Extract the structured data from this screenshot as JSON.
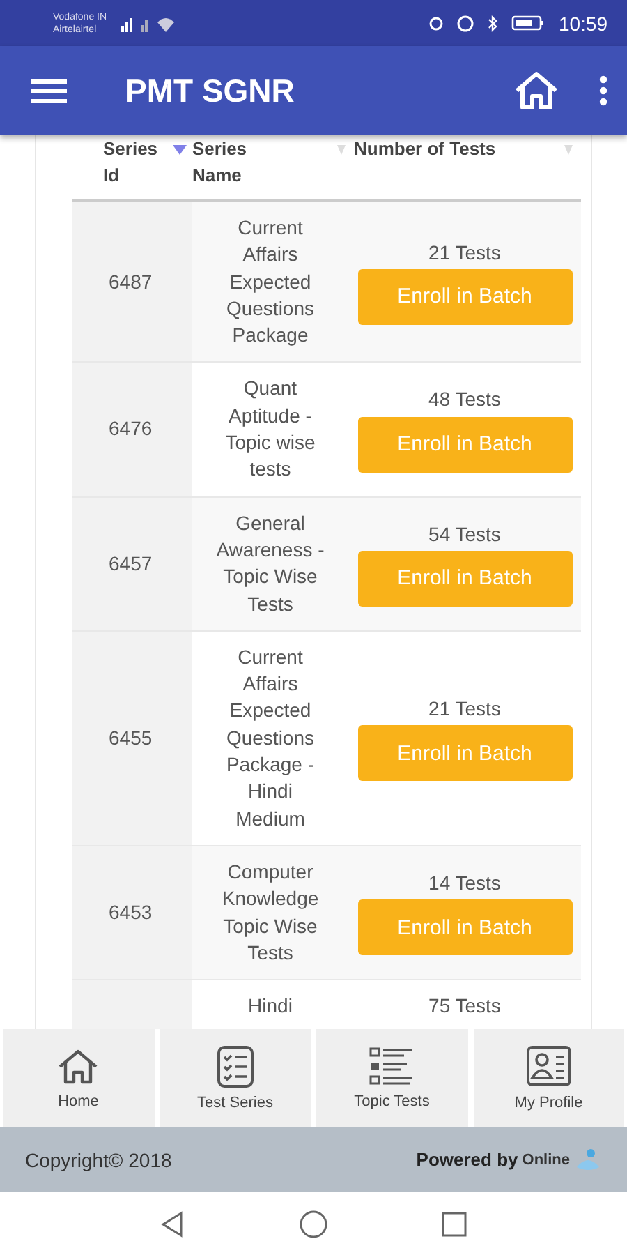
{
  "status_bar": {
    "carrier_lines": [
      "Vodafone IN",
      "Airtelairtel"
    ],
    "time": "10:59"
  },
  "app_bar": {
    "title": "PMT SGNR"
  },
  "table": {
    "columns": [
      {
        "label": "Series Id",
        "sorted": true
      },
      {
        "label": "Series Name",
        "sorted": false
      },
      {
        "label": "Number of Tests",
        "sorted": false
      }
    ],
    "rows": [
      {
        "id": "6487",
        "name": "Current Affairs Expected Questions Package",
        "tests": "21 Tests",
        "action": "Enroll in Batch"
      },
      {
        "id": "6476",
        "name": "Quant Aptitude - Topic wise tests",
        "tests": "48 Tests",
        "action": "Enroll in Batch"
      },
      {
        "id": "6457",
        "name": "General Awareness - Topic Wise Tests",
        "tests": "54 Tests",
        "action": "Enroll in Batch"
      },
      {
        "id": "6455",
        "name": "Current Affairs Expected Questions Package - Hindi Medium",
        "tests": "21 Tests",
        "action": "Enroll in Batch"
      },
      {
        "id": "6453",
        "name": "Computer Knowledge Topic Wise Tests",
        "tests": "14 Tests",
        "action": "Enroll in Batch"
      },
      {
        "name": "Hindi",
        "tests": "75 Tests"
      }
    ]
  },
  "bottom_nav": [
    {
      "label": "Home"
    },
    {
      "label": "Test Series"
    },
    {
      "label": "Topic Tests"
    },
    {
      "label": "My Profile"
    }
  ],
  "footer": {
    "copyright": "Copyright© 2018",
    "powered_by": "Powered by",
    "brand": "Online"
  }
}
